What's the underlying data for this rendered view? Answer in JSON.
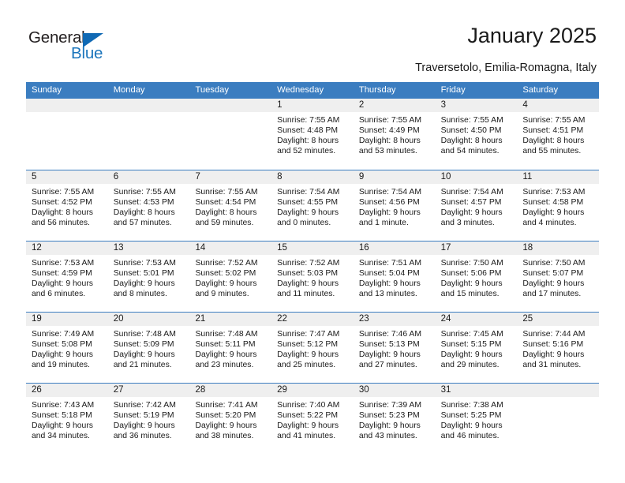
{
  "brand": {
    "name_part1": "General",
    "name_part2": "Blue",
    "accent_color": "#1b75bc",
    "triangle_color": "#1069b4"
  },
  "header": {
    "title": "January 2025",
    "subtitle": "Traversetolo, Emilia-Romagna, Italy"
  },
  "calendar": {
    "header_bg": "#3b7dc0",
    "day_band_bg": "#efefef",
    "weekdays": [
      "Sunday",
      "Monday",
      "Tuesday",
      "Wednesday",
      "Thursday",
      "Friday",
      "Saturday"
    ],
    "weeks": [
      [
        {
          "day": "",
          "sunrise": "",
          "sunset": "",
          "daylight_line1": "",
          "daylight_line2": ""
        },
        {
          "day": "",
          "sunrise": "",
          "sunset": "",
          "daylight_line1": "",
          "daylight_line2": ""
        },
        {
          "day": "",
          "sunrise": "",
          "sunset": "",
          "daylight_line1": "",
          "daylight_line2": ""
        },
        {
          "day": "1",
          "sunrise": "Sunrise: 7:55 AM",
          "sunset": "Sunset: 4:48 PM",
          "daylight_line1": "Daylight: 8 hours",
          "daylight_line2": "and 52 minutes."
        },
        {
          "day": "2",
          "sunrise": "Sunrise: 7:55 AM",
          "sunset": "Sunset: 4:49 PM",
          "daylight_line1": "Daylight: 8 hours",
          "daylight_line2": "and 53 minutes."
        },
        {
          "day": "3",
          "sunrise": "Sunrise: 7:55 AM",
          "sunset": "Sunset: 4:50 PM",
          "daylight_line1": "Daylight: 8 hours",
          "daylight_line2": "and 54 minutes."
        },
        {
          "day": "4",
          "sunrise": "Sunrise: 7:55 AM",
          "sunset": "Sunset: 4:51 PM",
          "daylight_line1": "Daylight: 8 hours",
          "daylight_line2": "and 55 minutes."
        }
      ],
      [
        {
          "day": "5",
          "sunrise": "Sunrise: 7:55 AM",
          "sunset": "Sunset: 4:52 PM",
          "daylight_line1": "Daylight: 8 hours",
          "daylight_line2": "and 56 minutes."
        },
        {
          "day": "6",
          "sunrise": "Sunrise: 7:55 AM",
          "sunset": "Sunset: 4:53 PM",
          "daylight_line1": "Daylight: 8 hours",
          "daylight_line2": "and 57 minutes."
        },
        {
          "day": "7",
          "sunrise": "Sunrise: 7:55 AM",
          "sunset": "Sunset: 4:54 PM",
          "daylight_line1": "Daylight: 8 hours",
          "daylight_line2": "and 59 minutes."
        },
        {
          "day": "8",
          "sunrise": "Sunrise: 7:54 AM",
          "sunset": "Sunset: 4:55 PM",
          "daylight_line1": "Daylight: 9 hours",
          "daylight_line2": "and 0 minutes."
        },
        {
          "day": "9",
          "sunrise": "Sunrise: 7:54 AM",
          "sunset": "Sunset: 4:56 PM",
          "daylight_line1": "Daylight: 9 hours",
          "daylight_line2": "and 1 minute."
        },
        {
          "day": "10",
          "sunrise": "Sunrise: 7:54 AM",
          "sunset": "Sunset: 4:57 PM",
          "daylight_line1": "Daylight: 9 hours",
          "daylight_line2": "and 3 minutes."
        },
        {
          "day": "11",
          "sunrise": "Sunrise: 7:53 AM",
          "sunset": "Sunset: 4:58 PM",
          "daylight_line1": "Daylight: 9 hours",
          "daylight_line2": "and 4 minutes."
        }
      ],
      [
        {
          "day": "12",
          "sunrise": "Sunrise: 7:53 AM",
          "sunset": "Sunset: 4:59 PM",
          "daylight_line1": "Daylight: 9 hours",
          "daylight_line2": "and 6 minutes."
        },
        {
          "day": "13",
          "sunrise": "Sunrise: 7:53 AM",
          "sunset": "Sunset: 5:01 PM",
          "daylight_line1": "Daylight: 9 hours",
          "daylight_line2": "and 8 minutes."
        },
        {
          "day": "14",
          "sunrise": "Sunrise: 7:52 AM",
          "sunset": "Sunset: 5:02 PM",
          "daylight_line1": "Daylight: 9 hours",
          "daylight_line2": "and 9 minutes."
        },
        {
          "day": "15",
          "sunrise": "Sunrise: 7:52 AM",
          "sunset": "Sunset: 5:03 PM",
          "daylight_line1": "Daylight: 9 hours",
          "daylight_line2": "and 11 minutes."
        },
        {
          "day": "16",
          "sunrise": "Sunrise: 7:51 AM",
          "sunset": "Sunset: 5:04 PM",
          "daylight_line1": "Daylight: 9 hours",
          "daylight_line2": "and 13 minutes."
        },
        {
          "day": "17",
          "sunrise": "Sunrise: 7:50 AM",
          "sunset": "Sunset: 5:06 PM",
          "daylight_line1": "Daylight: 9 hours",
          "daylight_line2": "and 15 minutes."
        },
        {
          "day": "18",
          "sunrise": "Sunrise: 7:50 AM",
          "sunset": "Sunset: 5:07 PM",
          "daylight_line1": "Daylight: 9 hours",
          "daylight_line2": "and 17 minutes."
        }
      ],
      [
        {
          "day": "19",
          "sunrise": "Sunrise: 7:49 AM",
          "sunset": "Sunset: 5:08 PM",
          "daylight_line1": "Daylight: 9 hours",
          "daylight_line2": "and 19 minutes."
        },
        {
          "day": "20",
          "sunrise": "Sunrise: 7:48 AM",
          "sunset": "Sunset: 5:09 PM",
          "daylight_line1": "Daylight: 9 hours",
          "daylight_line2": "and 21 minutes."
        },
        {
          "day": "21",
          "sunrise": "Sunrise: 7:48 AM",
          "sunset": "Sunset: 5:11 PM",
          "daylight_line1": "Daylight: 9 hours",
          "daylight_line2": "and 23 minutes."
        },
        {
          "day": "22",
          "sunrise": "Sunrise: 7:47 AM",
          "sunset": "Sunset: 5:12 PM",
          "daylight_line1": "Daylight: 9 hours",
          "daylight_line2": "and 25 minutes."
        },
        {
          "day": "23",
          "sunrise": "Sunrise: 7:46 AM",
          "sunset": "Sunset: 5:13 PM",
          "daylight_line1": "Daylight: 9 hours",
          "daylight_line2": "and 27 minutes."
        },
        {
          "day": "24",
          "sunrise": "Sunrise: 7:45 AM",
          "sunset": "Sunset: 5:15 PM",
          "daylight_line1": "Daylight: 9 hours",
          "daylight_line2": "and 29 minutes."
        },
        {
          "day": "25",
          "sunrise": "Sunrise: 7:44 AM",
          "sunset": "Sunset: 5:16 PM",
          "daylight_line1": "Daylight: 9 hours",
          "daylight_line2": "and 31 minutes."
        }
      ],
      [
        {
          "day": "26",
          "sunrise": "Sunrise: 7:43 AM",
          "sunset": "Sunset: 5:18 PM",
          "daylight_line1": "Daylight: 9 hours",
          "daylight_line2": "and 34 minutes."
        },
        {
          "day": "27",
          "sunrise": "Sunrise: 7:42 AM",
          "sunset": "Sunset: 5:19 PM",
          "daylight_line1": "Daylight: 9 hours",
          "daylight_line2": "and 36 minutes."
        },
        {
          "day": "28",
          "sunrise": "Sunrise: 7:41 AM",
          "sunset": "Sunset: 5:20 PM",
          "daylight_line1": "Daylight: 9 hours",
          "daylight_line2": "and 38 minutes."
        },
        {
          "day": "29",
          "sunrise": "Sunrise: 7:40 AM",
          "sunset": "Sunset: 5:22 PM",
          "daylight_line1": "Daylight: 9 hours",
          "daylight_line2": "and 41 minutes."
        },
        {
          "day": "30",
          "sunrise": "Sunrise: 7:39 AM",
          "sunset": "Sunset: 5:23 PM",
          "daylight_line1": "Daylight: 9 hours",
          "daylight_line2": "and 43 minutes."
        },
        {
          "day": "31",
          "sunrise": "Sunrise: 7:38 AM",
          "sunset": "Sunset: 5:25 PM",
          "daylight_line1": "Daylight: 9 hours",
          "daylight_line2": "and 46 minutes."
        },
        {
          "day": "",
          "sunrise": "",
          "sunset": "",
          "daylight_line1": "",
          "daylight_line2": ""
        }
      ]
    ]
  }
}
